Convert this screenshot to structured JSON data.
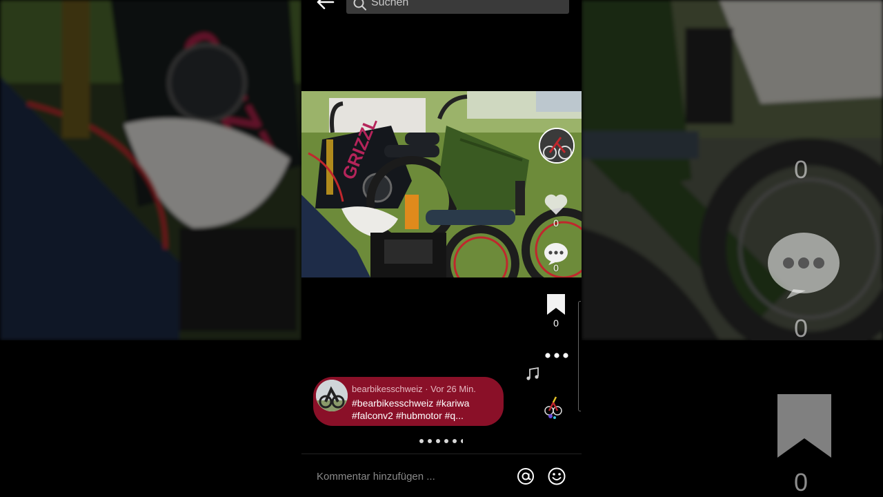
{
  "search": {
    "placeholder": "Suchen"
  },
  "post": {
    "author": "bearbikesschweiz",
    "time": "Vor 26 Min.",
    "header": "bearbikesschweiz · Vor 26 Min.",
    "caption_line1": "#bearbikesschweiz #kariwa",
    "caption_line2": "#falconv2  #hubmotor #q...",
    "photo_brand_text": "GRIZZL"
  },
  "actions": {
    "like_count": "0",
    "comment_count": "0",
    "save_count": "0"
  },
  "side_counts": {
    "a": "0",
    "b": "0",
    "c": "0"
  },
  "pager": {
    "total": 5,
    "active": 1
  },
  "comment": {
    "placeholder": "Kommentar hinzufügen ..."
  },
  "colors": {
    "caption_bg": "#8a1028",
    "background": "#000000",
    "search_bg": "#3a3a3a"
  }
}
